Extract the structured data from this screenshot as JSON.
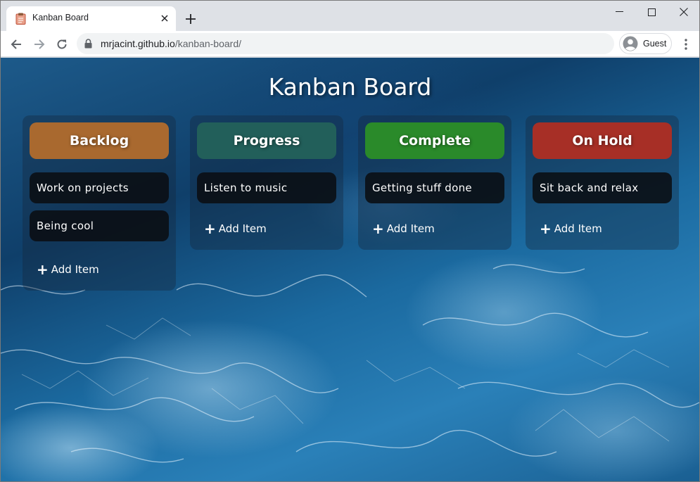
{
  "browser": {
    "tab": {
      "title": "Kanban Board",
      "favicon": "clipboard-icon"
    },
    "url": {
      "host": "mrjacint.github.io",
      "path": "/kanban-board/"
    },
    "profile": {
      "label": "Guest"
    }
  },
  "page": {
    "title": "Kanban Board",
    "columns": [
      {
        "title": "Backlog",
        "color": "#a9692f",
        "items": [
          "Work on projects",
          "Being cool"
        ],
        "add_label": "Add Item"
      },
      {
        "title": "Progress",
        "color": "#225f5a",
        "items": [
          "Listen to music"
        ],
        "add_label": "Add Item"
      },
      {
        "title": "Complete",
        "color": "#2a8a2a",
        "items": [
          "Getting stuff done"
        ],
        "add_label": "Add Item"
      },
      {
        "title": "On Hold",
        "color": "#a72f26",
        "items": [
          "Sit back and relax"
        ],
        "add_label": "Add Item"
      }
    ]
  }
}
